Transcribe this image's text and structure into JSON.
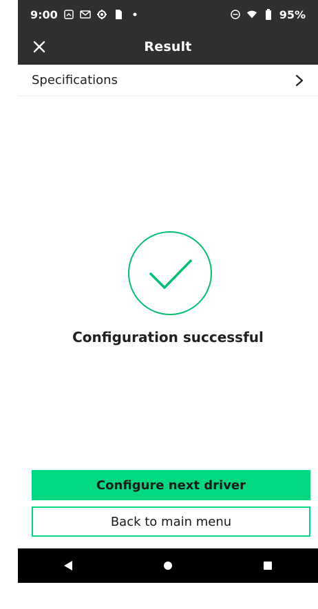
{
  "status_bar": {
    "time": "9:00",
    "battery_percent": "95%",
    "left_icons": [
      "screenshot-icon",
      "gmail-icon",
      "settings-cog-icon",
      "sim-icon",
      "dot-icon"
    ],
    "right_icons": [
      "do-not-disturb-icon",
      "wifi-icon",
      "battery-icon"
    ]
  },
  "app_bar": {
    "title": "Result"
  },
  "specifications": {
    "label": "Specifications"
  },
  "result": {
    "message": "Configuration successful"
  },
  "buttons": {
    "primary": "Configure next driver",
    "secondary": "Back to main menu"
  },
  "colors": {
    "accent": "#00d982",
    "bar": "#2f2f2f"
  }
}
